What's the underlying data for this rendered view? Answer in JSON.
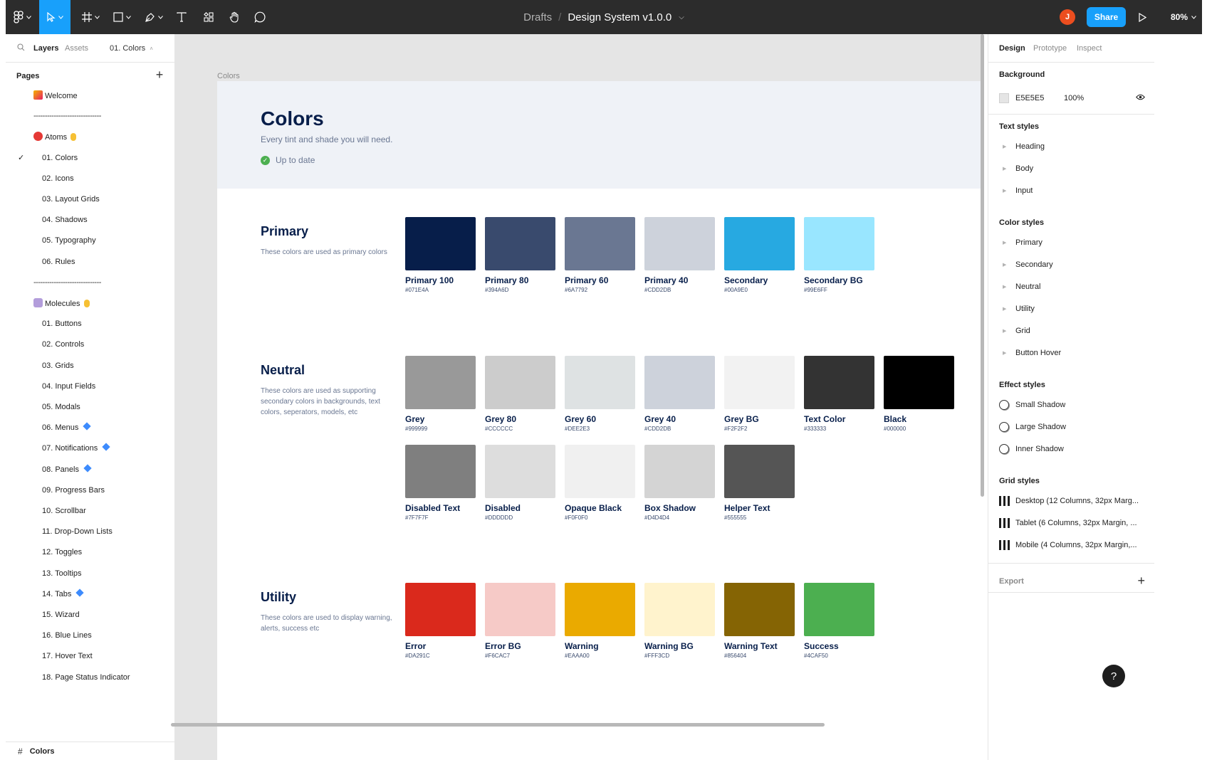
{
  "toolbar": {
    "breadcrumb_drafts": "Drafts",
    "breadcrumb_sep": "/",
    "file_name": "Design System v1.0.0",
    "avatar_initial": "J",
    "share_label": "Share",
    "zoom": "80%",
    "tools": [
      "main-menu",
      "move",
      "frame",
      "shape",
      "pen",
      "text",
      "components",
      "hand",
      "comment"
    ]
  },
  "left_panel": {
    "tabs": [
      "Layers",
      "Assets"
    ],
    "current_page_tab": "01. Colors",
    "pages_header": "Pages",
    "pages": [
      {
        "label": "Welcome",
        "type": "top",
        "emoji": "party"
      },
      {
        "label": "------------------------------",
        "type": "divider"
      },
      {
        "label": "Atoms",
        "type": "top",
        "emoji": "red",
        "suffix": "point"
      },
      {
        "label": "01. Colors",
        "type": "child",
        "selected": true
      },
      {
        "label": "02. Icons",
        "type": "child"
      },
      {
        "label": "03. Layout Grids",
        "type": "child"
      },
      {
        "label": "04. Shadows",
        "type": "child"
      },
      {
        "label": "05. Typography",
        "type": "child"
      },
      {
        "label": "06. Rules",
        "type": "child"
      },
      {
        "label": "------------------------------",
        "type": "divider"
      },
      {
        "label": "Molecules",
        "type": "top",
        "emoji": "atom",
        "suffix": "point"
      },
      {
        "label": "01. Buttons",
        "type": "child"
      },
      {
        "label": "02. Controls",
        "type": "child"
      },
      {
        "label": "03. Grids",
        "type": "child"
      },
      {
        "label": "04. Input Fields",
        "type": "child"
      },
      {
        "label": "05. Modals",
        "type": "child"
      },
      {
        "label": "06. Menus",
        "type": "child",
        "diamond": true
      },
      {
        "label": "07. Notifications",
        "type": "child",
        "diamond": true
      },
      {
        "label": "08. Panels",
        "type": "child",
        "diamond": true
      },
      {
        "label": "09. Progress Bars",
        "type": "child"
      },
      {
        "label": "10. Scrollbar",
        "type": "child"
      },
      {
        "label": "11. Drop-Down Lists",
        "type": "child"
      },
      {
        "label": "12. Toggles",
        "type": "child"
      },
      {
        "label": "13. Tooltips",
        "type": "child"
      },
      {
        "label": "14. Tabs",
        "type": "child",
        "diamond": true
      },
      {
        "label": "15. Wizard",
        "type": "child"
      },
      {
        "label": "16. Blue Lines",
        "type": "child"
      },
      {
        "label": "17. Hover Text",
        "type": "child"
      },
      {
        "label": "18. Page Status Indicator",
        "type": "child"
      }
    ],
    "footer_layer": "Colors"
  },
  "canvas": {
    "frame_label": "Colors",
    "header": {
      "title": "Colors",
      "subtitle": "Every tint and shade you will need.",
      "status": "Up to date"
    },
    "sections": [
      {
        "title": "Primary",
        "description": "These colors are used as primary colors",
        "rows": [
          [
            {
              "name": "Primary 100",
              "hex": "#071E4A",
              "color": "#071E4A"
            },
            {
              "name": "Primary 80",
              "hex": "#394A6D",
              "color": "#394A6D"
            },
            {
              "name": "Primary 60",
              "hex": "#6A7792",
              "color": "#6A7792"
            },
            {
              "name": "Primary 40",
              "hex": "#CDD2DB",
              "color": "#CDD2DB"
            },
            {
              "name": "Secondary",
              "hex": "#00A9E0",
              "color": "#27A9E1"
            },
            {
              "name": "Secondary BG",
              "hex": "#99E6FF",
              "color": "#99E6FF"
            }
          ]
        ]
      },
      {
        "title": "Neutral",
        "description": "These colors are used as supporting secondary colors in backgrounds, text colors, seperators, models, etc",
        "rows": [
          [
            {
              "name": "Grey",
              "hex": "#999999",
              "color": "#999999"
            },
            {
              "name": "Grey 80",
              "hex": "#CCCCCC",
              "color": "#CCCCCC"
            },
            {
              "name": "Grey 60",
              "hex": "#DEE2E3",
              "color": "#DEE2E3"
            },
            {
              "name": "Grey 40",
              "hex": "#CDD2DB",
              "color": "#CDD2DB"
            },
            {
              "name": "Grey BG",
              "hex": "#F2F2F2",
              "color": "#F2F2F2"
            },
            {
              "name": "Text Color",
              "hex": "#333333",
              "color": "#333333"
            },
            {
              "name": "Black",
              "hex": "#000000",
              "color": "#000000"
            }
          ],
          [
            {
              "name": "Disabled Text",
              "hex": "#7F7F7F",
              "color": "#7F7F7F"
            },
            {
              "name": "Disabled",
              "hex": "#DDDDDD",
              "color": "#DDDDDD"
            },
            {
              "name": "Opaque Black",
              "hex": "#F0F0F0",
              "color": "#F0F0F0"
            },
            {
              "name": "Box Shadow",
              "hex": "#D4D4D4",
              "color": "#D4D4D4"
            },
            {
              "name": "Helper Text",
              "hex": "#555555",
              "color": "#555555"
            }
          ]
        ]
      },
      {
        "title": "Utility",
        "description": "These colors are used to display warning, alerts, success etc",
        "rows": [
          [
            {
              "name": "Error",
              "hex": "#DA291C",
              "color": "#DA291C"
            },
            {
              "name": "Error BG",
              "hex": "#F6CAC7",
              "color": "#F6CAC7"
            },
            {
              "name": "Warning",
              "hex": "#EAAA00",
              "color": "#EAAA00"
            },
            {
              "name": "Warning BG",
              "hex": "#FFF3CD",
              "color": "#FFF3CD"
            },
            {
              "name": "Warning Text",
              "hex": "#856404",
              "color": "#856404"
            },
            {
              "name": "Success",
              "hex": "#4CAF50",
              "color": "#4CAF50"
            }
          ]
        ]
      }
    ]
  },
  "right_panel": {
    "tabs": [
      "Design",
      "Prototype",
      "Inspect"
    ],
    "background": {
      "label": "Background",
      "hex": "E5E5E5",
      "opacity": "100%"
    },
    "text_styles": {
      "label": "Text styles",
      "items": [
        "Heading",
        "Body",
        "Input"
      ]
    },
    "color_styles": {
      "label": "Color styles",
      "items": [
        "Primary",
        "Secondary",
        "Neutral",
        "Utility",
        "Grid",
        "Button Hover"
      ]
    },
    "effect_styles": {
      "label": "Effect styles",
      "items": [
        "Small Shadow",
        "Large Shadow",
        "Inner Shadow"
      ]
    },
    "grid_styles": {
      "label": "Grid styles",
      "items": [
        "Desktop (12 Columns, 32px Marg...",
        "Tablet (6 Columns, 32px Margin, ...",
        "Mobile (4 Columns, 32px Margin,..."
      ]
    },
    "export_label": "Export",
    "help_label": "?"
  }
}
